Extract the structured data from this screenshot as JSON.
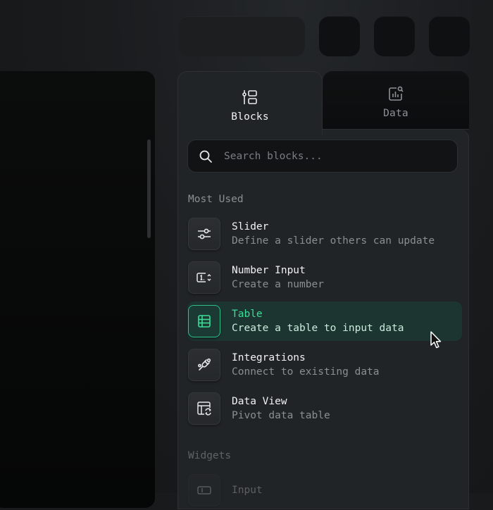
{
  "panel": {
    "tabs": [
      {
        "label": "Blocks",
        "icon": "blocks-icon",
        "active": true
      },
      {
        "label": "Data",
        "icon": "data-chart-icon",
        "active": false
      }
    ],
    "search": {
      "placeholder": "Search blocks...",
      "value": ""
    },
    "sections": [
      {
        "title": "Most Used",
        "items": [
          {
            "name": "Slider",
            "desc": "Define a slider others can update",
            "icon": "slider-icon"
          },
          {
            "name": "Number Input",
            "desc": "Create a number",
            "icon": "number-input-icon"
          },
          {
            "name": "Table",
            "desc": "Create a table to input data",
            "icon": "table-icon",
            "active": true
          },
          {
            "name": "Integrations",
            "desc": "Connect to existing data",
            "icon": "plug-icon"
          },
          {
            "name": "Data View",
            "desc": "Pivot data table",
            "icon": "data-view-icon"
          }
        ]
      },
      {
        "title": "Widgets",
        "items": [
          {
            "name": "Input",
            "desc": "",
            "icon": "input-icon"
          }
        ]
      }
    ]
  },
  "colors": {
    "accent": "#3ddc98",
    "active_bg": "#1d3530",
    "panel_bg": "#212427"
  }
}
